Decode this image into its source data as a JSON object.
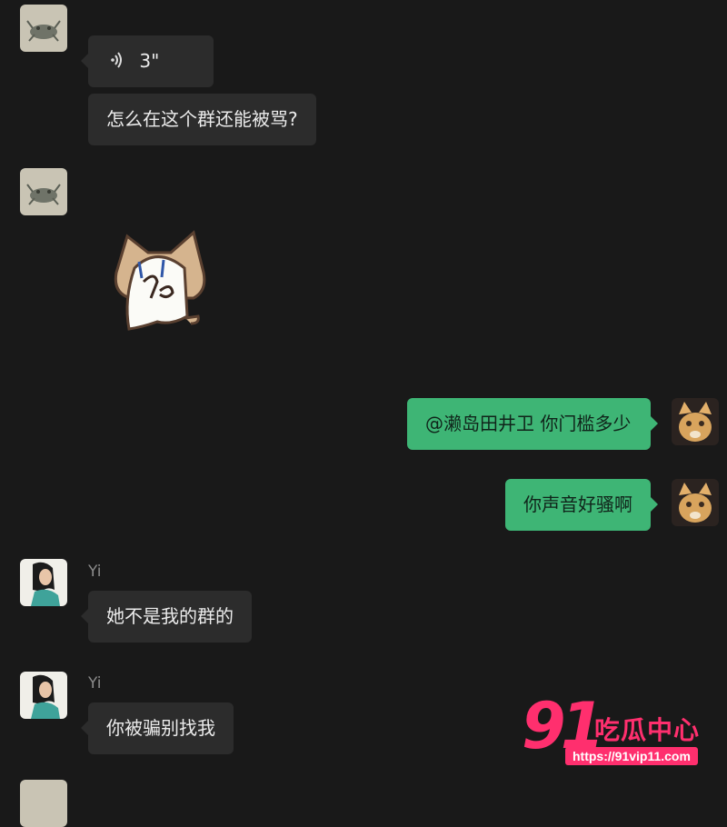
{
  "messages": {
    "voice": {
      "duration": "3\""
    },
    "m1": {
      "text": "怎么在这个群还能被骂?"
    },
    "m2": {
      "text": "@濑岛田井卫 你门槛多少"
    },
    "m3": {
      "text": "你声音好骚啊"
    },
    "m4": {
      "sender": "Yi",
      "text": "她不是我的群的"
    },
    "m5": {
      "sender": "Yi",
      "text": "你被骗别找我"
    }
  },
  "watermark": {
    "number": "91",
    "title": "吃瓜中心",
    "url": "https://91vip11.com"
  },
  "colors": {
    "background": "#191919",
    "incoming_bubble": "#2c2c2c",
    "outgoing_bubble": "#3eb575",
    "watermark": "#ff2f6e"
  },
  "icons": [
    "voice-icon",
    "cat-sticker"
  ]
}
